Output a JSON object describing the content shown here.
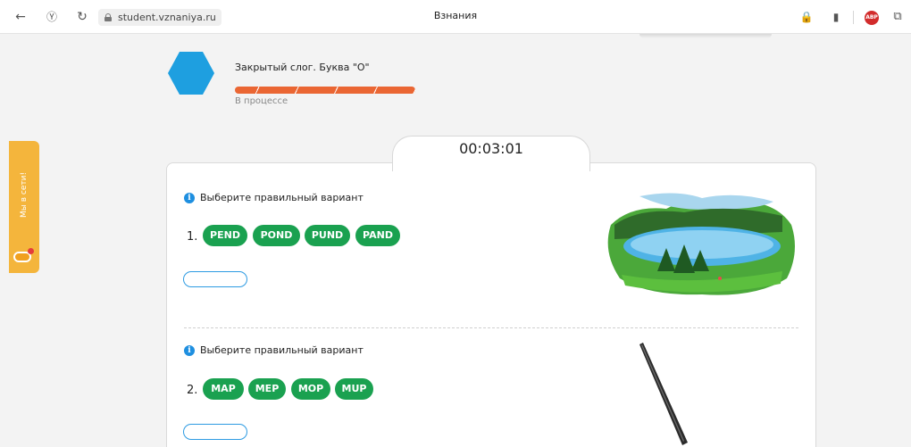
{
  "browser": {
    "url": "student.vznaniya.ru",
    "page_title": "Взнания",
    "extension_badge": "ABP"
  },
  "lesson": {
    "title": "Закрытый слог. Буква \"О\"",
    "status": "В процессе",
    "progress_color": "#ea6633",
    "hex_color": "#1e9fe0"
  },
  "side_widget": {
    "label": "Мы в сети!"
  },
  "timer": "00:03:01",
  "questions": [
    {
      "instruction": "Выберите правильный вариант",
      "number": "1.",
      "options": [
        "PEND",
        "POND",
        "PUND",
        "PAND"
      ],
      "image": "pond-icon"
    },
    {
      "instruction": "Выберите правильный вариант",
      "number": "2.",
      "options": [
        "MAP",
        "MEP",
        "MOP",
        "MUP"
      ],
      "image": "mop-icon"
    }
  ],
  "colors": {
    "option_green": "#1aa150",
    "answer_border": "#2d9be2",
    "widget_orange": "#f4b53c"
  }
}
